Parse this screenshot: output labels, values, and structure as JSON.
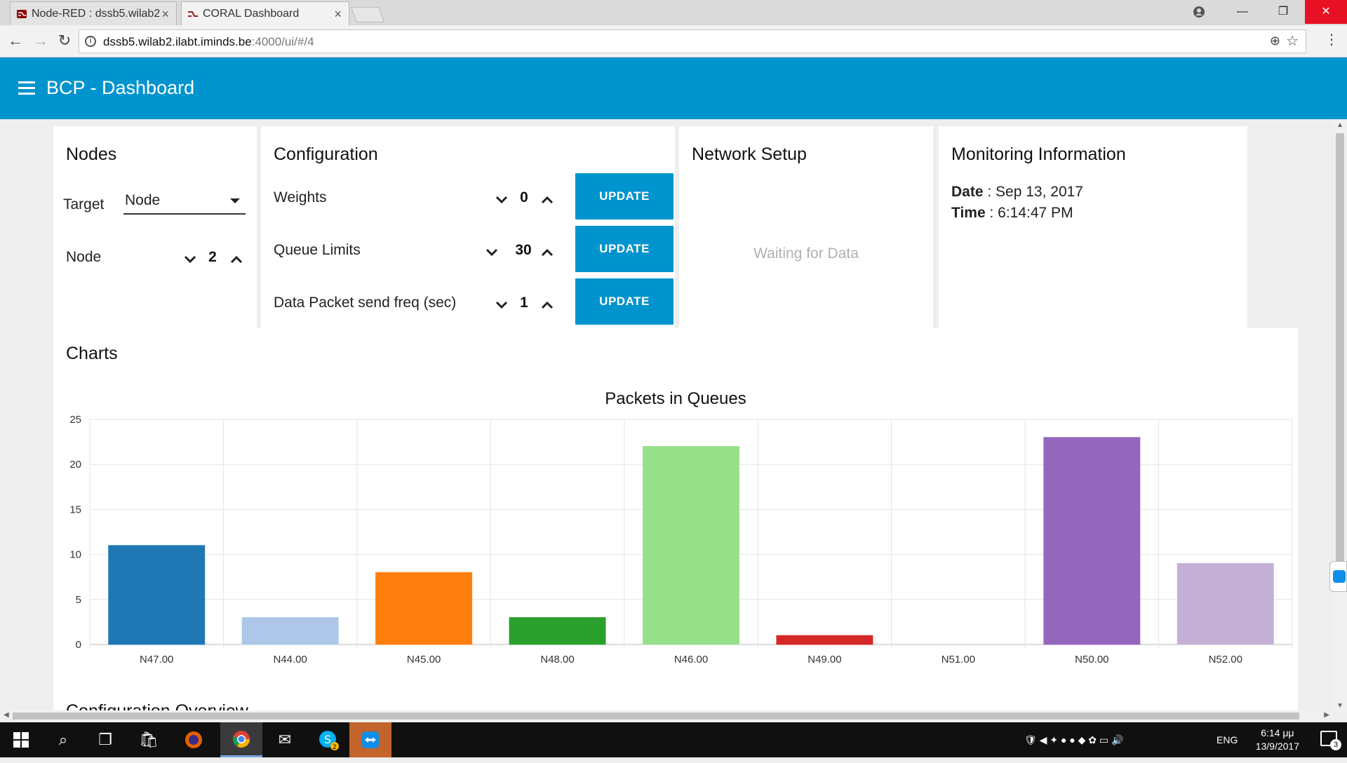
{
  "browser": {
    "tabs": [
      {
        "label": "Node-RED : dssb5.wilab2",
        "active": false
      },
      {
        "label": "CORAL Dashboard",
        "active": true
      }
    ],
    "url_host": "dssb5.wilab2.ilabt.iminds.be",
    "url_path": ":4000/ui/#/4"
  },
  "app": {
    "title": "BCP - Dashboard",
    "header_color": "#0094ce"
  },
  "nodes_card": {
    "title": "Nodes",
    "target_label": "Target",
    "target_value": "Node",
    "node_label": "Node",
    "node_value": "2"
  },
  "configuration_card": {
    "title": "Configuration",
    "rows": [
      {
        "label": "Weights",
        "value": "0",
        "button": "UPDATE"
      },
      {
        "label": "Queue Limits",
        "value": "30",
        "button": "UPDATE"
      },
      {
        "label": "Data Packet send freq (sec)",
        "value": "1",
        "button": "UPDATE"
      }
    ]
  },
  "network_card": {
    "title": "Network Setup",
    "placeholder": "Waiting for Data"
  },
  "monitoring_card": {
    "title": "Monitoring Information",
    "date_label": "Date",
    "date_value": "Sep 13, 2017",
    "time_label": "Time",
    "time_value": "6:14:47 PM"
  },
  "charts_card": {
    "title": "Charts",
    "next_section_partial": "Configuration Overview"
  },
  "chart_data": {
    "type": "bar",
    "title": "Packets in Queues",
    "categories": [
      "N47.00",
      "N44.00",
      "N45.00",
      "N48.00",
      "N46.00",
      "N49.00",
      "N51.00",
      "N50.00",
      "N52.00"
    ],
    "values": [
      11,
      3,
      8,
      3,
      22,
      1,
      0,
      23,
      9
    ],
    "colors": [
      "#1f77b4",
      "#aec7e8",
      "#ff7f0e",
      "#2ca02c",
      "#98df8a",
      "#d62728",
      "#ff9896",
      "#9467bd",
      "#c5b0d5"
    ],
    "ylim": [
      0,
      25
    ],
    "yticks": [
      0,
      5,
      10,
      15,
      20,
      25
    ],
    "grid": true
  },
  "taskbar": {
    "language": "ENG",
    "time": "6:14 μμ",
    "date": "13/9/2017",
    "notification_count": "3",
    "skype_badge": "2"
  }
}
